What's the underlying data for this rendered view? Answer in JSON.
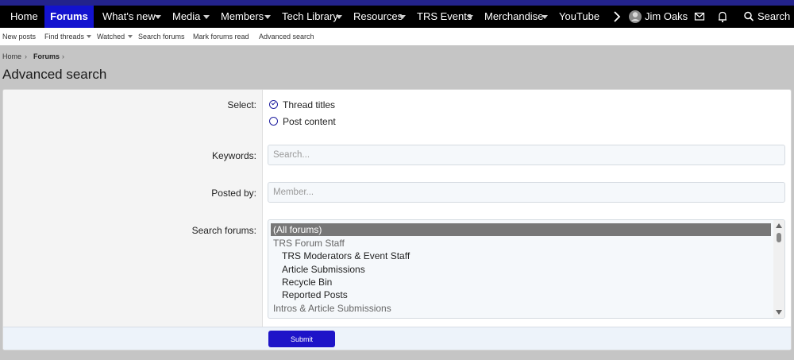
{
  "nav": {
    "home": "Home",
    "forums": "Forums",
    "whats_new": "What's new",
    "media": "Media",
    "members": "Members",
    "tech_library": "Tech Library",
    "resources": "Resources",
    "trs_events": "TRS Events",
    "merchandise": "Merchandise",
    "youtube": "YouTube",
    "user_name": "Jim Oaks",
    "search": "Search"
  },
  "subnav": {
    "new_posts": "New posts",
    "find_threads": "Find threads",
    "watched": "Watched",
    "search_forums": "Search forums",
    "mark_read": "Mark forums read",
    "advanced_search": "Advanced search"
  },
  "breadcrumb": {
    "home": "Home",
    "forums": "Forums"
  },
  "page_title": "Advanced search",
  "form": {
    "select_label": "Select:",
    "option_thread_titles": "Thread titles",
    "option_post_content": "Post content",
    "keywords_label": "Keywords:",
    "keywords_placeholder": "Search...",
    "posted_by_label": "Posted by:",
    "posted_by_placeholder": "Member...",
    "search_forums_label": "Search forums:",
    "forums": [
      "(All forums)",
      "TRS Forum Staff",
      "TRS Moderators & Event Staff",
      "Article Submissions",
      "Recycle Bin",
      "Reported Posts",
      "Intros & Article Submissions"
    ],
    "submit_label": "Submit"
  },
  "colors": {
    "nav_bg": "#000000",
    "nav_active": "#1313cf",
    "top_strip": "#23238c",
    "submit_bg": "#1e14c8",
    "page_bg": "#c5c5c5"
  }
}
